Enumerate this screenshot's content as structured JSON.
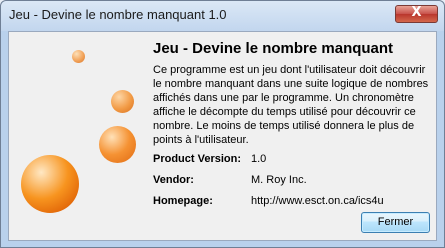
{
  "window": {
    "title": "Jeu - Devine le nombre manquant 1.0",
    "close_symbol": "X"
  },
  "content": {
    "heading": "Jeu - Devine le nombre manquant",
    "description": "Ce programme est un jeu dont l'utilisateur doit découvrir le nombre manquant dans une suite logique de nombres affichés dans une par le programme. Un chronomètre affiche le décompte du temps utilisé pour découvrir ce nombre. Le moins de temps utilisé donnera le plus de points à l'utilisateur."
  },
  "info": {
    "version_label": "Product Version:",
    "version_value": "1.0",
    "vendor_label": "Vendor:",
    "vendor_value": "M. Roy Inc.",
    "homepage_label": "Homepage:",
    "homepage_value": "http://www.esct.on.ca/ics4u"
  },
  "buttons": {
    "close_label": "Fermer"
  },
  "colors": {
    "accent_orange": "#f28a1e",
    "titlebar": "#c2d6ee",
    "button_border": "#3c7fb1"
  }
}
